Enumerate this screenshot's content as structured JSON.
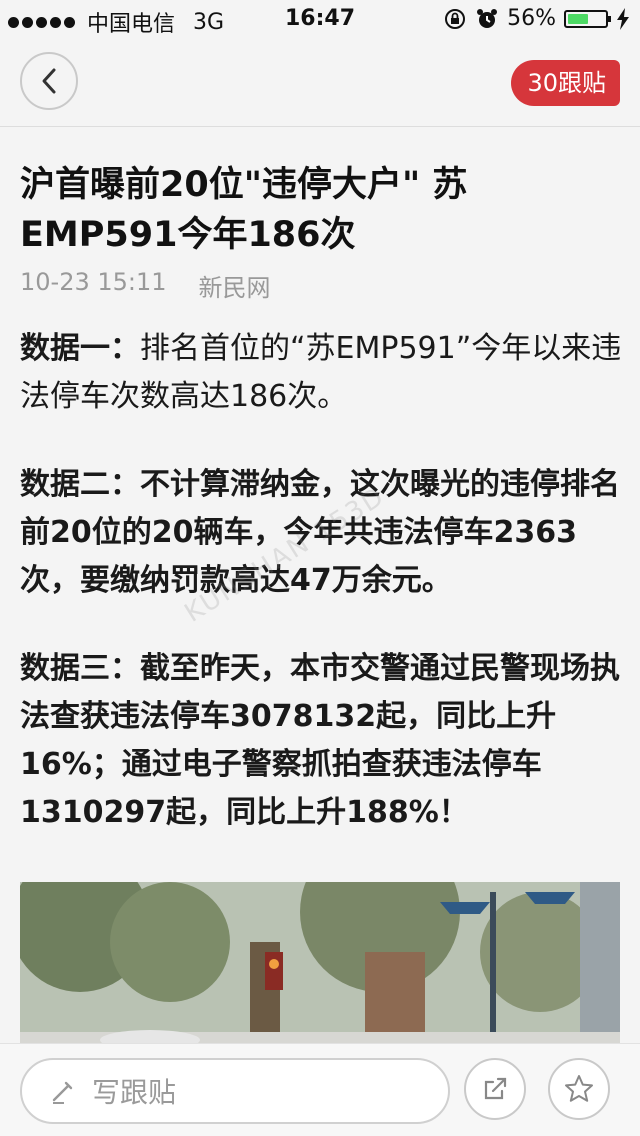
{
  "status_bar": {
    "carrier": "中国电信",
    "network": "3G",
    "time": "16:47",
    "battery": "56%",
    "battery_level": 0.56,
    "icons": [
      "signal-dots-icon",
      "rotation-lock-icon",
      "alarm-icon",
      "battery-icon",
      "charging-bolt-icon"
    ]
  },
  "nav": {
    "back_icon": "chevron-left-icon",
    "comments_badge": "30跟贴",
    "accent_color": "#d6363b"
  },
  "article": {
    "title": "沪首曝前20位\"违停大户\" 苏EMP591今年186次",
    "datetime": "10-23 15:11",
    "source": "新民网",
    "paragraphs": [
      {
        "lead": "数据一：",
        "text": "排名首位的“苏EMP591”今年以来违法停车次数高达186次。"
      },
      {
        "lead": "数据二：",
        "text": "不计算滞纳金，这次曝光的违停排名前20位的20辆车，今年共违法停车2363次，要缴纳罚款高达47万余元。"
      },
      {
        "lead": "数据三：",
        "text": "截至昨天，本市交警通过民警现场执法查获违法停车3078132起，同比上升16%；通过电子警察抓拍查获违法停车1310297起，同比上升188%！"
      }
    ],
    "watermark": "KUNSHAN 153D"
  },
  "bottom_bar": {
    "comment_placeholder": "写跟贴",
    "icons": [
      "pencil-icon",
      "share-icon",
      "star-icon"
    ]
  }
}
